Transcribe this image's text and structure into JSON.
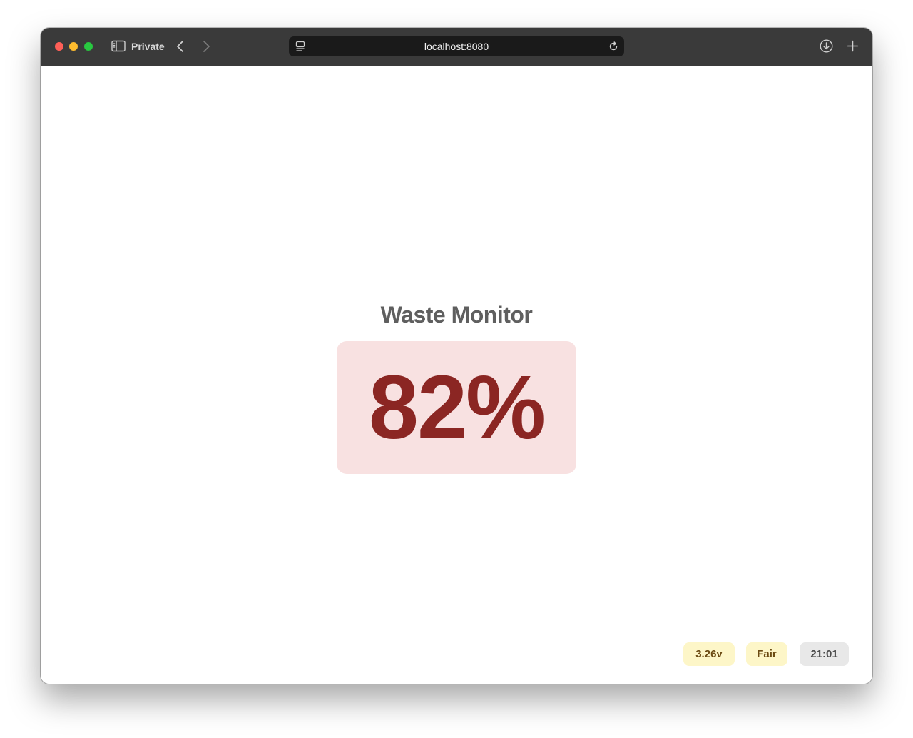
{
  "browser": {
    "mode_label": "Private",
    "url": "localhost:8080"
  },
  "icons": {
    "sidebar": "sidebar-icon",
    "back": "chevron-left-icon",
    "forward": "chevron-right-icon",
    "site": "site-info-icon",
    "reload": "reload-icon",
    "download": "download-icon",
    "new_tab": "plus-icon"
  },
  "page": {
    "title": "Waste Monitor",
    "fill_level": "82%",
    "status": {
      "voltage": "3.26v",
      "signal": "Fair",
      "time": "21:01"
    }
  },
  "colors": {
    "card_background": "#f8e1e1",
    "level_text": "#8b2623",
    "warning_badge": "#fdf6c8",
    "neutral_badge": "#e8e8e8"
  }
}
